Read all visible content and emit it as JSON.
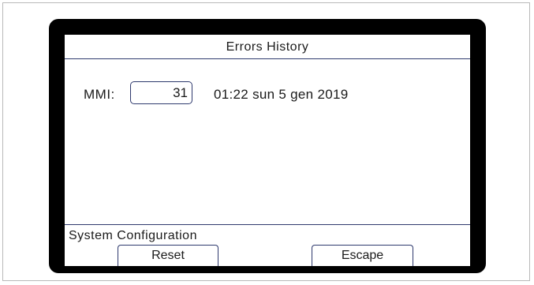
{
  "screen": {
    "title": "Errors History"
  },
  "errors": {
    "mmi_label": "MMI:",
    "mmi_value": "31",
    "timestamp": "01:22 sun 5 gen 2019"
  },
  "status_bar": {
    "text": "System Configuration"
  },
  "soft_keys": {
    "reset_label": "Reset",
    "escape_label": "Escape"
  },
  "colors": {
    "bezel": "#000000",
    "screen_background": "#ffffff",
    "rule_color": "#2f3a6e"
  }
}
